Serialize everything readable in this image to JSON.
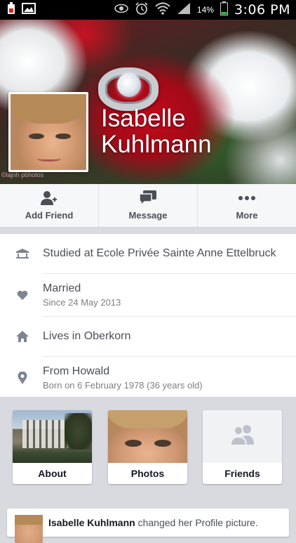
{
  "status_bar": {
    "time": "3:06 PM",
    "battery_percent": "14%",
    "icons": [
      "notification-battery-icon",
      "image-icon",
      "eye-icon",
      "alarm-icon",
      "wifi-icon",
      "signal-icon",
      "battery-icon"
    ]
  },
  "profile": {
    "name": "Isabelle Kuhlmann",
    "cover_watermark": "©lajnh pbhotos"
  },
  "actions": [
    {
      "label": "Add Friend",
      "icon": "add-friend-icon"
    },
    {
      "label": "Message",
      "icon": "message-icon"
    },
    {
      "label": "More",
      "icon": "more-icon"
    }
  ],
  "info": {
    "education": "Studied at Ecole Privée Sainte Anne Ettelbruck",
    "relationship": "Married",
    "relationship_since": "Since 24 May 2013",
    "lives_in": "Lives in Oberkorn",
    "from": "From Howald",
    "born": "Born on 6 February 1978 (36 years old)"
  },
  "tiles": [
    {
      "label": "About"
    },
    {
      "label": "Photos"
    },
    {
      "label": "Friends"
    }
  ],
  "story": {
    "author": "Isabelle Kuhlmann",
    "action": "changed her Profile picture."
  },
  "colors": {
    "status_bar": "#000000",
    "action_bar": "#f6f7f8",
    "page_background": "#d8dadf",
    "icon_gray": "#4b4f56"
  }
}
